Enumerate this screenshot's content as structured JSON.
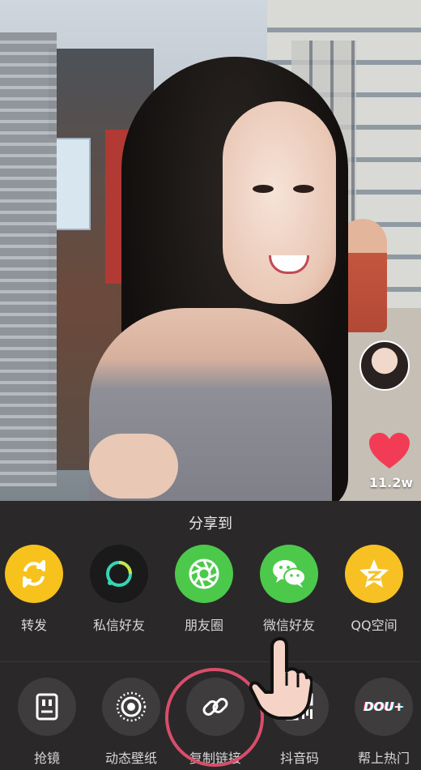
{
  "header": {
    "share_title": "分享到"
  },
  "video": {
    "likes": "11.2w"
  },
  "share_targets": [
    {
      "label": "转发",
      "icon": "repost-icon",
      "color": "#f7c21b"
    },
    {
      "label": "私信好友",
      "icon": "message-friend-icon",
      "color": "#1a1a1a"
    },
    {
      "label": "朋友圈",
      "icon": "moments-icon",
      "color": "#4cc94a"
    },
    {
      "label": "微信好友",
      "icon": "wechat-icon",
      "color": "#4cc94a"
    },
    {
      "label": "QQ空间",
      "icon": "qzone-icon",
      "color": "#f8c123"
    }
  ],
  "actions": [
    {
      "label": "抢镜",
      "icon": "duet-icon"
    },
    {
      "label": "动态壁纸",
      "icon": "live-wallpaper-icon"
    },
    {
      "label": "复制链接",
      "icon": "copy-link-icon"
    },
    {
      "label": "抖音码",
      "icon": "qr-code-icon"
    },
    {
      "label": "帮上热门",
      "icon": "dou-plus-icon",
      "badge_text": "DOU+"
    }
  ],
  "colors": {
    "heart": "#f23c56",
    "highlight_ring": "#d94d6b",
    "sheet_bg": "#2a2829"
  }
}
